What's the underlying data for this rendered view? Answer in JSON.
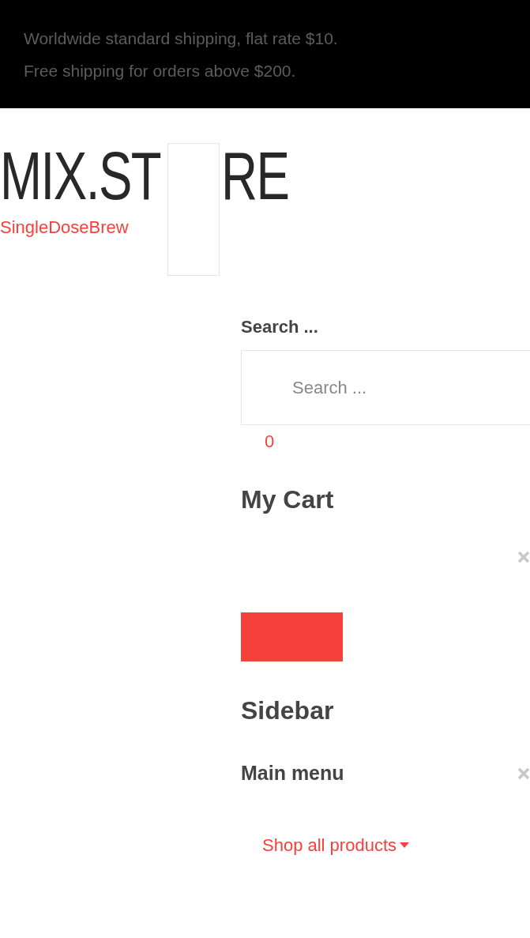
{
  "top_bar": {
    "lines": [
      "Worldwide standard shipping, flat rate $10.",
      "Free shipping for orders above $200."
    ]
  },
  "header": {
    "logo_parts": [
      "MIX.ST",
      "RE"
    ],
    "tagline": "SingleDoseBrew"
  },
  "search": {
    "label": "Search ...",
    "placeholder": "Search ..."
  },
  "cart": {
    "count": "0",
    "title": "My Cart"
  },
  "sidebar": {
    "title": "Sidebar",
    "menu_title": "Main menu",
    "items": [
      {
        "label": "Shop all products",
        "expanded": false
      }
    ]
  }
}
